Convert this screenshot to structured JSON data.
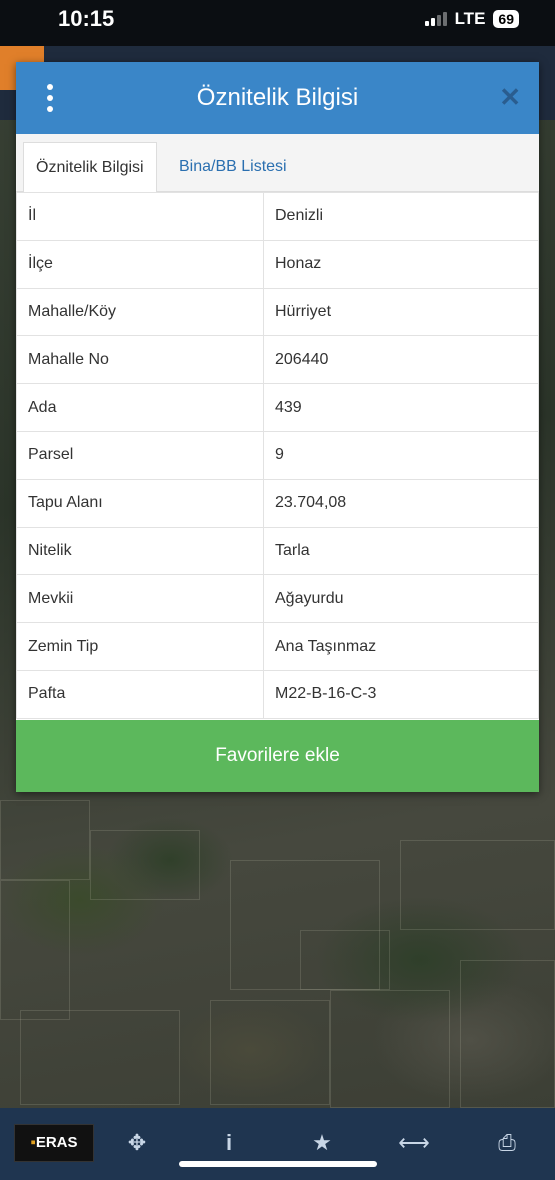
{
  "status_bar": {
    "time": "10:15",
    "network": "LTE",
    "battery": "69"
  },
  "dialog": {
    "title": "Öznitelik Bilgisi",
    "close_icon": "close-icon",
    "menu_icon": "more-vertical-icon",
    "tabs": [
      {
        "label": "Öznitelik Bilgisi",
        "active": true
      },
      {
        "label": "Bina/BB Listesi",
        "active": false
      }
    ],
    "rows": [
      {
        "key": "İl",
        "value": "Denizli"
      },
      {
        "key": "İlçe",
        "value": "Honaz"
      },
      {
        "key": "Mahalle/Köy",
        "value": "Hürriyet"
      },
      {
        "key": "Mahalle No",
        "value": "206440"
      },
      {
        "key": "Ada",
        "value": "439"
      },
      {
        "key": "Parsel",
        "value": "9"
      },
      {
        "key": "Tapu Alanı",
        "value": "23.704,08"
      },
      {
        "key": "Nitelik",
        "value": "Tarla"
      },
      {
        "key": "Mevkii",
        "value": "Ağayurdu"
      },
      {
        "key": "Zemin Tip",
        "value": "Ana Taşınmaz"
      },
      {
        "key": "Pafta",
        "value": "M22-B-16-C-3"
      }
    ],
    "favorite_button": "Favorilere ekle"
  },
  "bottom_nav": {
    "logo": "ERAS",
    "items": [
      {
        "icon": "move-icon",
        "glyph": "✥"
      },
      {
        "icon": "info-icon",
        "glyph": "i"
      },
      {
        "icon": "star-icon",
        "glyph": "★"
      },
      {
        "icon": "measure-icon",
        "glyph": "⟷"
      },
      {
        "icon": "print-icon",
        "glyph": "⎙"
      }
    ]
  },
  "colors": {
    "header_blue": "#3a86c8",
    "favorite_green": "#5cb85c",
    "nav_bg": "#1f3550"
  }
}
